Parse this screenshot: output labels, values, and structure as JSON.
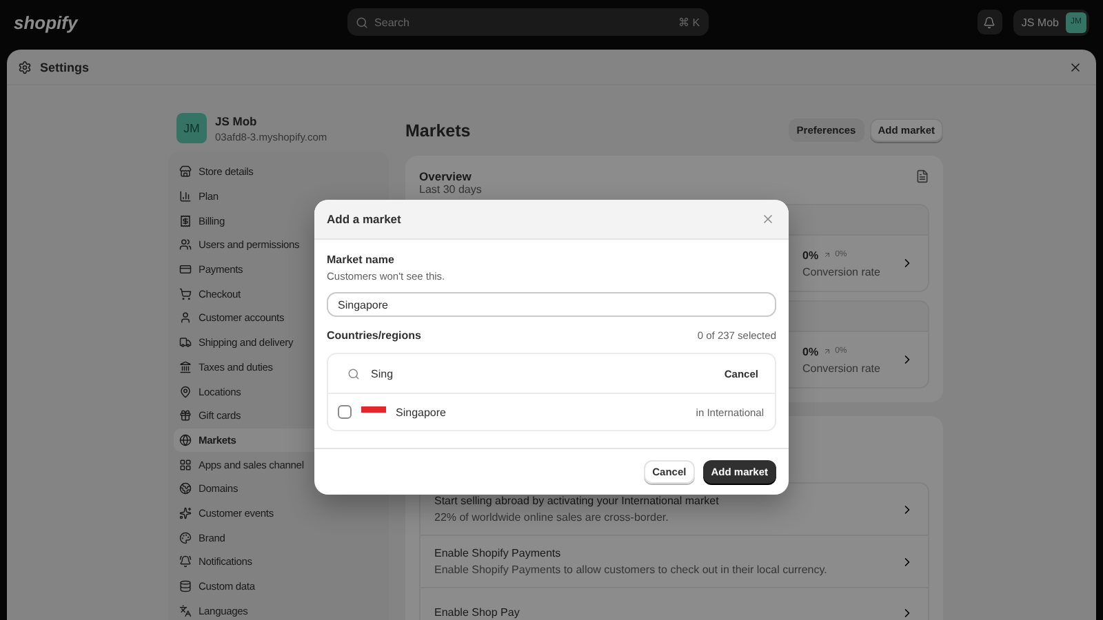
{
  "topbar": {
    "logo": "shopify",
    "search": {
      "placeholder": "Search",
      "shortcut": "⌘ K"
    },
    "user": {
      "name": "JS Mob",
      "initials": "JM"
    }
  },
  "settings": {
    "title": "Settings"
  },
  "store": {
    "initials": "JM",
    "name": "JS Mob",
    "domain": "03afd8-3.myshopify.com"
  },
  "sidebar": {
    "items": [
      {
        "label": "Store details",
        "selected": false
      },
      {
        "label": "Plan",
        "selected": false
      },
      {
        "label": "Billing",
        "selected": false
      },
      {
        "label": "Users and permissions",
        "selected": false
      },
      {
        "label": "Payments",
        "selected": false
      },
      {
        "label": "Checkout",
        "selected": false
      },
      {
        "label": "Customer accounts",
        "selected": false
      },
      {
        "label": "Shipping and delivery",
        "selected": false
      },
      {
        "label": "Taxes and duties",
        "selected": false
      },
      {
        "label": "Locations",
        "selected": false
      },
      {
        "label": "Gift cards",
        "selected": false
      },
      {
        "label": "Markets",
        "selected": true
      },
      {
        "label": "Apps and sales channel",
        "selected": false
      },
      {
        "label": "Domains",
        "selected": false
      },
      {
        "label": "Customer events",
        "selected": false
      },
      {
        "label": "Brand",
        "selected": false
      },
      {
        "label": "Notifications",
        "selected": false
      },
      {
        "label": "Custom data",
        "selected": false
      },
      {
        "label": "Languages",
        "selected": false
      }
    ]
  },
  "page": {
    "title": "Markets",
    "buttons": [
      "Preferences",
      "Add market"
    ]
  },
  "overview": {
    "title": "Overview",
    "subtitle": "Last 30 days",
    "metrics": [
      {
        "value": "0%",
        "change": "0%",
        "label": "Conversion rate"
      },
      {
        "value": "0%",
        "change": "0%",
        "label": "Conversion rate"
      }
    ]
  },
  "suggestions": [
    {
      "title": "Start selling abroad by activating your International market",
      "text": "22% of worldwide online sales are cross-border."
    },
    {
      "title": "Enable Shopify Payments",
      "text": "Enable Shopify Payments to allow customers to check out in their local currency."
    },
    {
      "title": "Enable Shop Pay"
    }
  ],
  "modal": {
    "title": "Add a market",
    "name_label": "Market name",
    "name_help": "Customers won't see this.",
    "name_value": "Singapore",
    "regions_label": "Countries/regions",
    "selected_count": "0 of 237 selected",
    "search_value": "Sing",
    "search_cancel": "Cancel",
    "results": [
      {
        "name": "Singapore",
        "market": "in International",
        "checked": false
      }
    ],
    "buttons": [
      "Cancel",
      "Add market"
    ]
  }
}
